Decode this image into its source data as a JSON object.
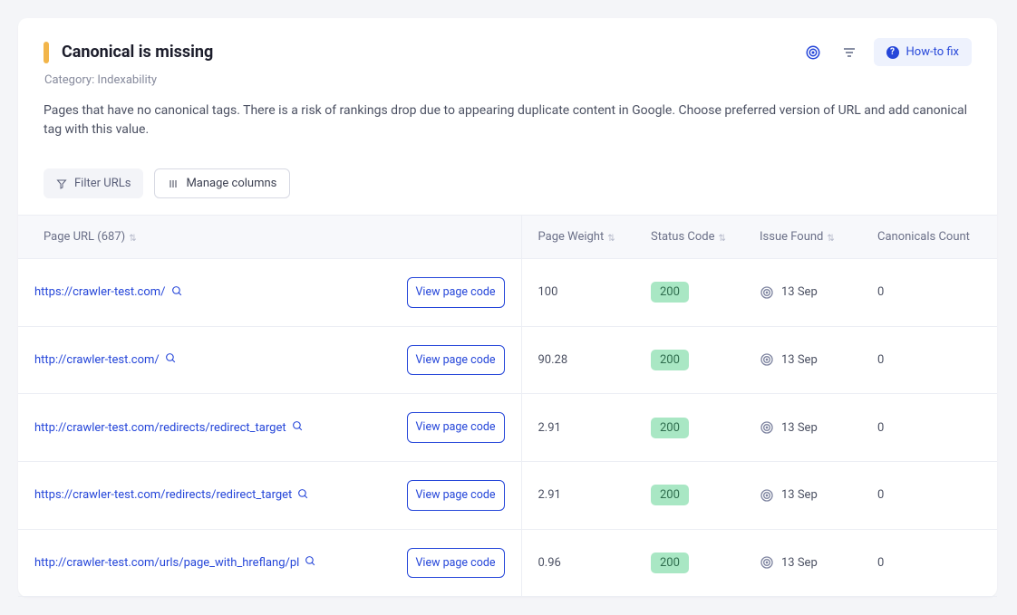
{
  "header": {
    "title": "Canonical is missing",
    "categoryLabel": "Category: Indexability",
    "description": "Pages that have no canonical tags. There is a risk of rankings drop due to appearing duplicate content in Google. Choose preferred version of URL and add canonical tag with this value.",
    "howToFix": "How-to fix"
  },
  "toolbar": {
    "filter": "Filter URLs",
    "manage": "Manage columns"
  },
  "table": {
    "columns": {
      "url": "Page URL (687)",
      "weight": "Page Weight",
      "status": "Status Code",
      "issueFound": "Issue Found",
      "canonicals": "Canonicals Count"
    },
    "viewCodeLabel": "View page code",
    "rows": [
      {
        "url": "https://crawler-test.com/",
        "weight": "100",
        "status": "200",
        "issueFound": "13 Sep",
        "canonicals": "0"
      },
      {
        "url": "http://crawler-test.com/",
        "weight": "90.28",
        "status": "200",
        "issueFound": "13 Sep",
        "canonicals": "0"
      },
      {
        "url": "http://crawler-test.com/redirects/redirect_target",
        "weight": "2.91",
        "status": "200",
        "issueFound": "13 Sep",
        "canonicals": "0"
      },
      {
        "url": "https://crawler-test.com/redirects/redirect_target",
        "weight": "2.91",
        "status": "200",
        "issueFound": "13 Sep",
        "canonicals": "0"
      },
      {
        "url": "http://crawler-test.com/urls/page_with_hreflang/pl",
        "weight": "0.96",
        "status": "200",
        "issueFound": "13 Sep",
        "canonicals": "0"
      }
    ]
  }
}
